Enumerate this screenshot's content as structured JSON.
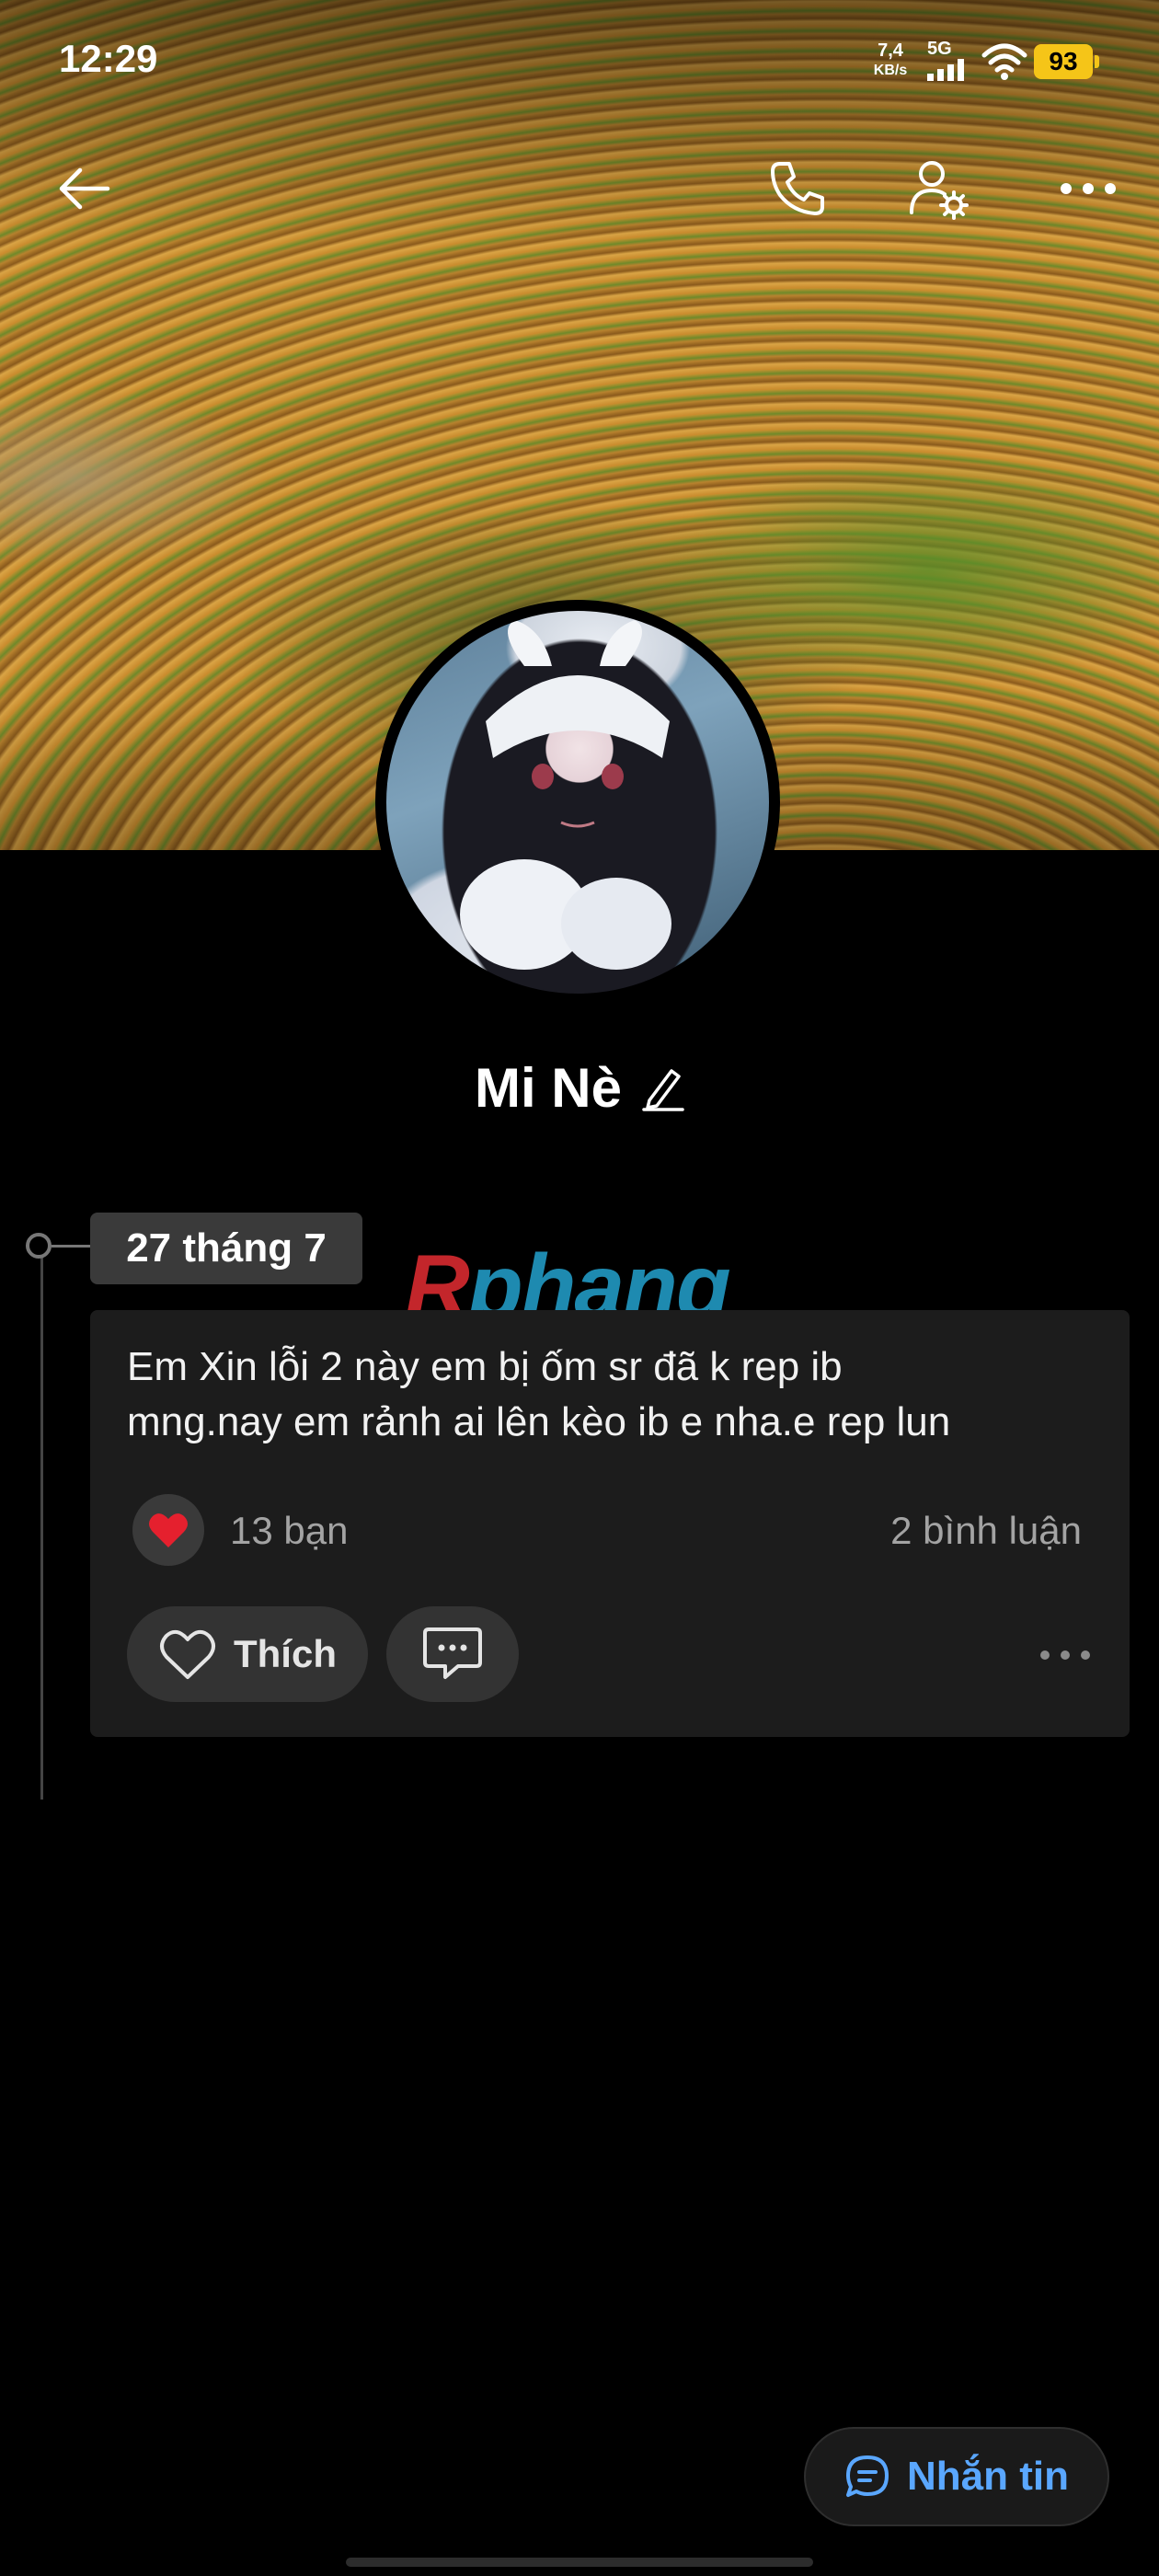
{
  "status_bar": {
    "time": "12:29",
    "net_speed_value": "7,4",
    "net_speed_unit": "KB/s",
    "network_type": "5G",
    "battery": "93"
  },
  "header": {
    "back_icon": "back-arrow-icon",
    "call_icon": "phone-icon",
    "settings_icon": "user-settings-icon",
    "more_icon": "more-horizontal-icon"
  },
  "profile": {
    "name": "Mi Nè",
    "edit_icon": "pencil-icon"
  },
  "timeline": {
    "date": "27 tháng 7"
  },
  "watermark": {
    "first": "R",
    "rest": "phang"
  },
  "post": {
    "text_line1": "Em Xin lỗi 2 này em bị ốm sr đã k rep ib",
    "text_line2": "mng.nay em rảnh ai lên kèo ib e nha.e rep lun",
    "reaction_emoji": "❤️",
    "reaction_count": "13 bạn",
    "comment_count": "2 bình luận",
    "like_label": "Thích"
  },
  "message_button": {
    "label": "Nhắn tin"
  },
  "colors": {
    "accent_blue": "#5aa7ff",
    "battery_yellow": "#f5c518",
    "card_bg": "#1c1c1c"
  }
}
